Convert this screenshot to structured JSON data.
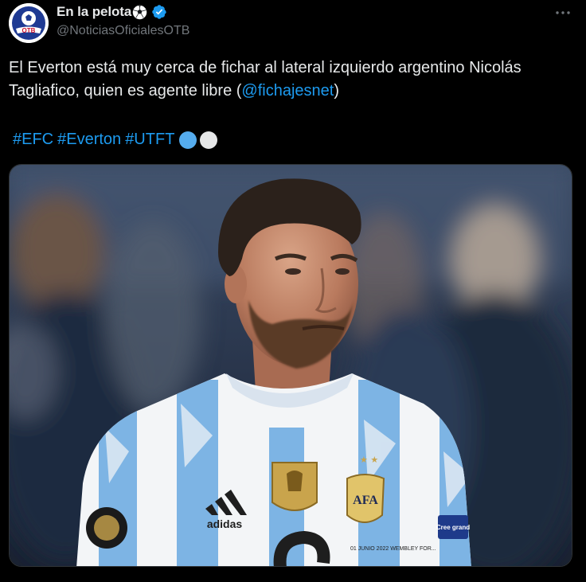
{
  "author": {
    "display_name": "En la pelota",
    "name_emoji": "soccer-ball-icon",
    "handle": "@NoticiasOficialesOTB",
    "verified": true,
    "avatar_text": "OTB"
  },
  "tweet": {
    "text_before": "El Everton está muy cerca de fichar al lateral izquierdo argentino Nicolás Tagliafico, quien es agente libre (",
    "mention": "@fichajesnet",
    "text_after": ")",
    "hashtags": [
      "#EFC",
      "#Everton",
      "#UTFT"
    ],
    "trailing_emojis": [
      "blue-circle-icon",
      "white-circle-icon"
    ]
  },
  "media": {
    "image_subject": "football-player-photo",
    "jersey_brand": "adidas",
    "badge_text": "AFA",
    "sleeve_text": "01 JUNIO 2022 WEMBLEY FOR...",
    "patch_text": "Cree grand"
  },
  "colors": {
    "background": "#000000",
    "text": "#e7e9ea",
    "muted": "#71767b",
    "accent": "#1d9bf0",
    "blue_circle": "#55acee",
    "white_circle": "#e6e7e8"
  }
}
